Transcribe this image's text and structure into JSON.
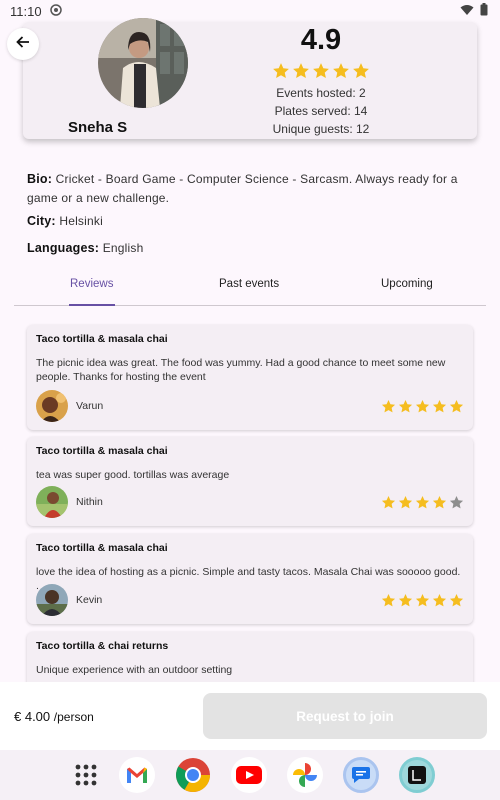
{
  "status": {
    "time": "11:10"
  },
  "profile": {
    "name": "Sneha S",
    "rating": "4.9",
    "rating_stars": 5,
    "events_hosted": "Events hosted: 2",
    "plates_served": "Plates served: 14",
    "unique_guests": "Unique guests: 12"
  },
  "about": {
    "bio_label": "Bio:",
    "bio_text": "Cricket - Board Game - Computer Science - Sarcasm. Always ready for a game or a new challenge.",
    "city_label": "City:",
    "city_value": "Helsinki",
    "languages_label": "Languages:",
    "languages_value": "English"
  },
  "tabs": [
    {
      "label": "Reviews",
      "active": true
    },
    {
      "label": "Past events",
      "active": false
    },
    {
      "label": "Upcoming",
      "active": false
    }
  ],
  "reviews": [
    {
      "title": "Taco tortilla & masala chai",
      "text": "The picnic idea was great. The food was yummy. Had a good chance to meet some new people. Thanks for hosting the event",
      "reviewer": "Varun",
      "rating": 5
    },
    {
      "title": "Taco tortilla & masala chai",
      "text": "tea was super good. tortillas was average",
      "reviewer": "Nithin",
      "rating": 4
    },
    {
      "title": "Taco tortilla & masala chai",
      "text": "love the idea of hosting as a picnic. Simple and tasty tacos. Masala Chai was sooooo good. .",
      "reviewer": "Kevin",
      "rating": 5
    },
    {
      "title": "Taco tortilla & chai returns",
      "text": "Unique experience with an outdoor setting",
      "reviewer": "",
      "rating": 0
    }
  ],
  "booking": {
    "price": "€ 4.00",
    "unit": "/person",
    "join_label": "Request to join"
  },
  "dock": [
    "apps-grid-icon",
    "gmail-icon",
    "chrome-icon",
    "youtube-icon",
    "photos-icon",
    "messages-icon",
    "app-icon"
  ],
  "colors": {
    "accent": "#6750a4",
    "star": "#f5bd1f",
    "star_empty": "#8e8e8e",
    "card": "#f4eef4",
    "background": "#fdf7fd"
  }
}
